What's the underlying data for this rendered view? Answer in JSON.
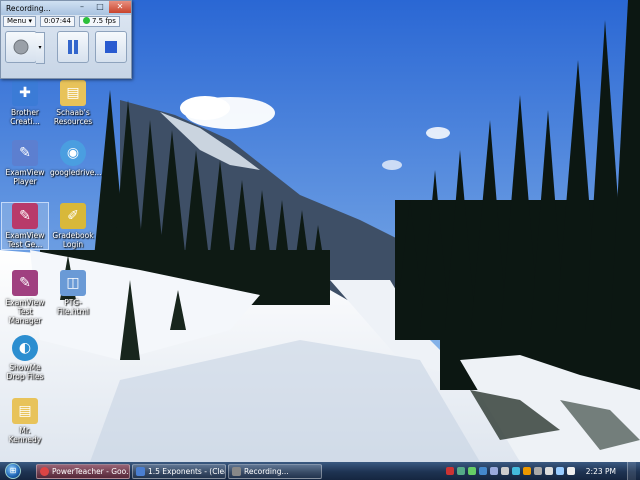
{
  "recorder": {
    "title": "Recording...",
    "menu_label": "Menu",
    "elapsed": "0:07:44",
    "fps": "7.5 fps",
    "record_icon": "record-circle-icon",
    "pause_icon": "pause-icon",
    "stop_icon": "stop-square-icon"
  },
  "desktop_icons": [
    {
      "label": "Brother Creati...",
      "icon": "brother-app-icon",
      "color": "#3b7bd6"
    },
    {
      "label": "Schaab's Resources",
      "icon": "folder-icon",
      "color": "#e8c35a"
    },
    {
      "label": "ExamView Player",
      "icon": "examview-icon",
      "color": "#5c7fd0"
    },
    {
      "label": "googledrive...",
      "icon": "cd-disc-icon",
      "color": "#4a9ee0"
    },
    {
      "label": "ExamView Test Ge...",
      "icon": "examview-icon",
      "color": "#b83a6a"
    },
    {
      "label": "Gradebook Login",
      "icon": "gradebook-icon",
      "color": "#d8b83a"
    },
    {
      "label": "ExamView Test Manager",
      "icon": "examview-icon",
      "color": "#a04080"
    },
    {
      "label": "PTG-File.html",
      "icon": "html-file-icon",
      "color": "#6a9ad6"
    },
    {
      "label": "ShowMe Drop Files",
      "icon": "showme-icon",
      "color": "#2c8ed0"
    },
    {
      "label": "Mr. Kennedy",
      "icon": "folder-icon",
      "color": "#e8c35a"
    }
  ],
  "taskbar": {
    "start_icon": "windows-start-orb-icon",
    "tasks": [
      {
        "label": "PowerTeacher - Goo...",
        "icon": "chrome-icon",
        "color": "#d44"
      },
      {
        "label": "1.5 Exponents - (Clea...",
        "icon": "document-icon",
        "color": "#4a7ed0"
      },
      {
        "label": "Recording...",
        "icon": "recorder-icon",
        "color": "#888"
      }
    ],
    "clock": "2:23 PM"
  },
  "colors": {
    "sky_top": "#2f6fd8",
    "sky_bottom": "#8fc0ee",
    "snow": "#f1f4f8",
    "forest": "#0f1a14"
  }
}
